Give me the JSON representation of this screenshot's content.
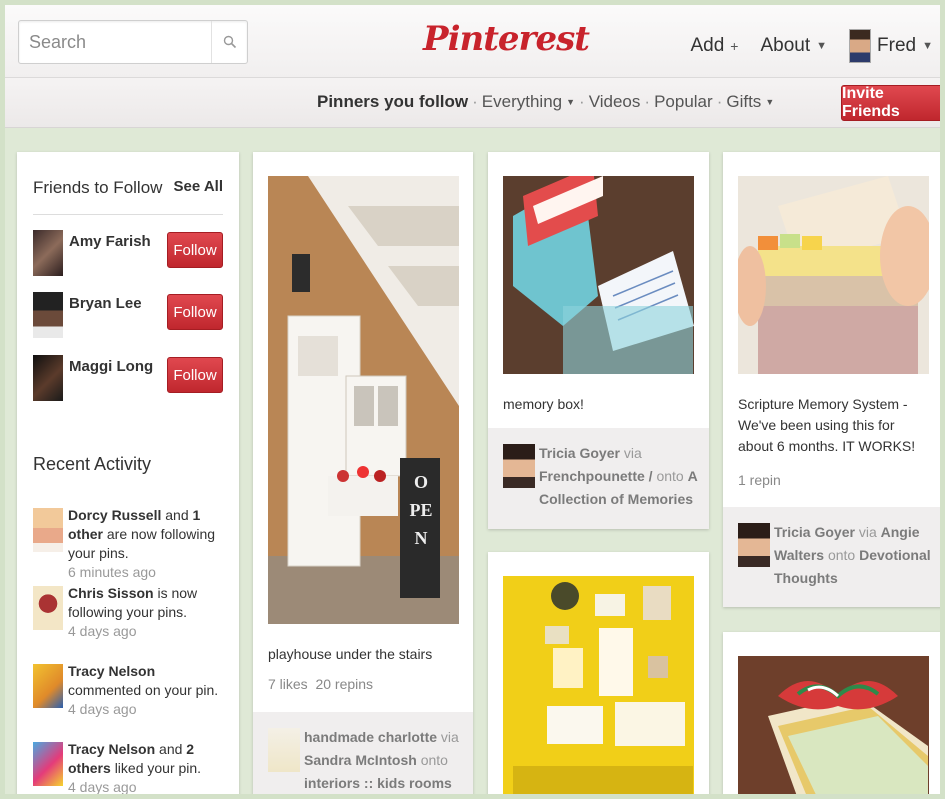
{
  "header": {
    "search_placeholder": "Search",
    "logo": "Pinterest",
    "add_label": "Add",
    "about_label": "About",
    "user_name": "Fred"
  },
  "subnav": {
    "pinners_you_follow": "Pinners you follow",
    "everything": "Everything",
    "videos": "Videos",
    "popular": "Popular",
    "gifts": "Gifts",
    "invite_label": "Invite Friends"
  },
  "sidebar": {
    "friends_heading": "Friends to Follow",
    "see_all": "See All",
    "follow_label": "Follow",
    "friends": [
      {
        "name": "Amy Farish"
      },
      {
        "name": "Bryan Lee"
      },
      {
        "name": "Maggi Long"
      }
    ],
    "recent_heading": "Recent Activity",
    "activity": [
      {
        "actor": "Dorcy Russell",
        "connector": "and",
        "others": "1 other",
        "text": "are now following your pins.",
        "time": "6 minutes ago"
      },
      {
        "actor": "Chris Sisson",
        "text": "is now following your pins.",
        "time": "4 days ago"
      },
      {
        "actor": "Tracy Nelson",
        "text": "commented on your pin.",
        "time": "4 days ago"
      },
      {
        "actor": "Tracy Nelson",
        "connector": "and",
        "others": "2 others",
        "text": "liked your pin.",
        "time": "4 days ago"
      }
    ]
  },
  "pins": {
    "playhouse": {
      "description": "playhouse under the stairs",
      "likes": "7 likes",
      "repins": "20 repins",
      "pinner": "handmade charlotte",
      "via": "via",
      "via_user": "Sandra McIntosh",
      "onto": "onto",
      "board": "interiors :: kids rooms"
    },
    "memory_box": {
      "description": "memory box!",
      "pinner": "Tricia Goyer",
      "via": "via",
      "via_user": "Frenchpounette",
      "slash": "/",
      "onto": "onto",
      "board": "A Collection of Memories"
    },
    "scripture": {
      "description": "Scripture Memory System - We've been using this for about 6 months. IT WORKS!",
      "repins": "1 repin",
      "pinner": "Tricia Goyer",
      "via": "via",
      "via_user": "Angie Walters",
      "onto": "onto",
      "board": "Devotional Thoughts"
    },
    "open_sign_text": "OPEN"
  },
  "colors": {
    "brand_red": "#c8232c",
    "frame_green": "#d3e1c8"
  }
}
